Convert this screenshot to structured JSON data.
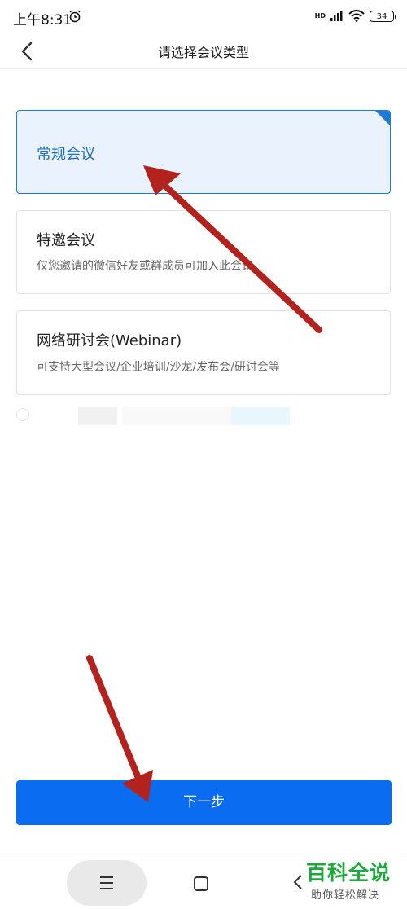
{
  "status_bar": {
    "time": "上午8:31",
    "network_label": "HD",
    "battery": "34"
  },
  "header": {
    "title": "请选择会议类型"
  },
  "options": [
    {
      "title": "常规会议",
      "description": "",
      "selected": true
    },
    {
      "title": "特邀会议",
      "description": "仅您邀请的微信好友或群成员可加入此会议",
      "selected": false
    },
    {
      "title": "网络研讨会(Webinar)",
      "description": "可支持大型会议/企业培训/沙龙/发布会/研讨会等",
      "selected": false
    }
  ],
  "next_button": {
    "label": "下一步"
  },
  "watermark": {
    "main": "百科全说",
    "sub": "助你轻松解决"
  },
  "colors": {
    "accent": "#0a6cf0",
    "selected_border": "#1f7ad6",
    "selected_bg": "#eaf3fd",
    "annotation_arrow": "#b3221c",
    "watermark_green": "#1ea83c"
  },
  "icons": [
    "alarm-icon",
    "signal-icon",
    "wifi-icon",
    "battery-icon",
    "back-chevron-icon",
    "menu-icon",
    "home-icon",
    "nav-back-icon"
  ]
}
